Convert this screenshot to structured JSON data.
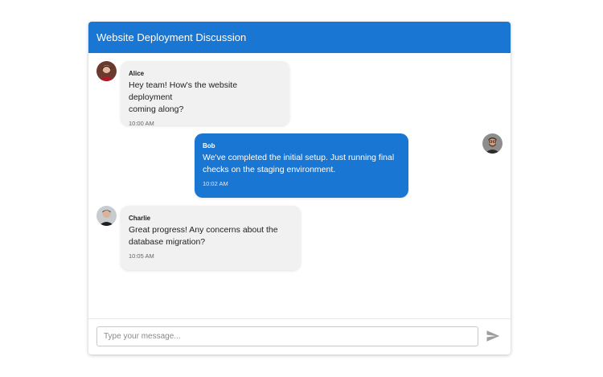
{
  "header": {
    "title": "Website Deployment Discussion"
  },
  "messages": [
    {
      "sender": "Alice",
      "text_line1": "Hey team! How's the website deployment",
      "text_line2": "coming along?",
      "time": "10:00 AM",
      "direction": "incoming"
    },
    {
      "sender": "Bob",
      "text_line1": "We've completed the initial setup. Just running final",
      "text_line2": "checks on the staging environment.",
      "time": "10:02 AM",
      "direction": "outgoing"
    },
    {
      "sender": "Charlie",
      "text_line1": "Great progress! Any concerns about the",
      "text_line2": "database migration?",
      "time": "10:05 AM",
      "direction": "incoming"
    }
  ],
  "composer": {
    "placeholder": "Type your message...",
    "value": "",
    "send_icon": "send-icon"
  },
  "colors": {
    "accent": "#1976d2",
    "incoming_bubble": "#f1f1f1",
    "send_icon": "#9e9e9e"
  }
}
